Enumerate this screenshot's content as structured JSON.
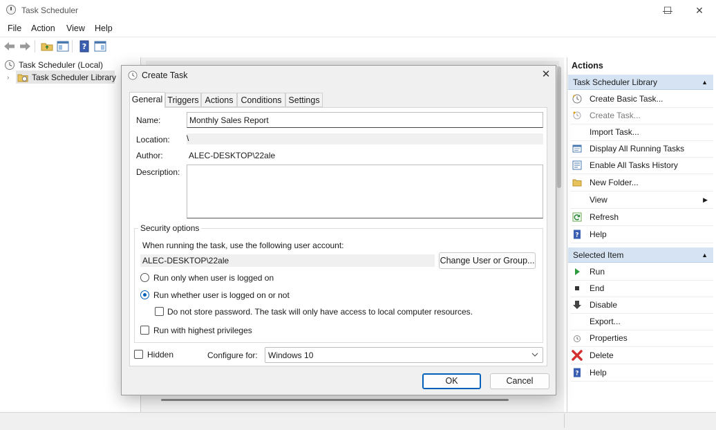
{
  "window": {
    "title": "Task Scheduler",
    "controls": [
      "—",
      "☐",
      "✕"
    ]
  },
  "menu": [
    "File",
    "Action",
    "View",
    "Help"
  ],
  "tree": {
    "root": "Task Scheduler (Local)",
    "library": "Task Scheduler Library"
  },
  "actions_pane": {
    "title": "Actions",
    "section1": "Task Scheduler Library",
    "section1_items": [
      "Create Basic Task...",
      "Create Task...",
      "Import Task...",
      "Display All Running Tasks",
      "Enable All Tasks History",
      "New Folder...",
      "View",
      "Refresh",
      "Help"
    ],
    "section2": "Selected Item",
    "section2_items": [
      "Run",
      "End",
      "Disable",
      "Export...",
      "Properties",
      "Delete",
      "Help"
    ]
  },
  "dialog": {
    "title": "Create Task",
    "tabs": [
      "General",
      "Triggers",
      "Actions",
      "Conditions",
      "Settings"
    ],
    "name_label": "Name:",
    "name_value": "Monthly Sales Report",
    "location_label": "Location:",
    "location_value": "\\",
    "author_label": "Author:",
    "author_value": "ALEC-DESKTOP\\22ale",
    "description_label": "Description:",
    "description_value": "",
    "security_title": "Security options",
    "account_prompt": "When running the task, use the following user account:",
    "account_value": "ALEC-DESKTOP\\22ale",
    "change_user_button": "Change User or Group...",
    "radio_logged_on": "Run only when user is logged on",
    "radio_whether": "Run whether user is logged on or not",
    "no_store_password": "Do not store password.  The task will only have access to local computer resources.",
    "highest_privileges": "Run with highest privileges",
    "hidden_label": "Hidden",
    "configure_label": "Configure for:",
    "configure_value": "Windows 10",
    "ok_button": "OK",
    "cancel_button": "Cancel"
  }
}
